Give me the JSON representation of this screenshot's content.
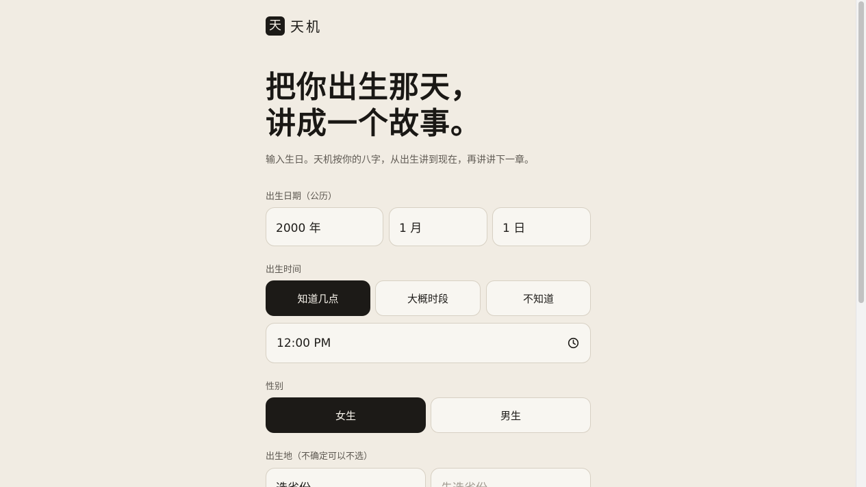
{
  "brand": {
    "logo_char": "天",
    "name": "天机"
  },
  "hero": {
    "line1": "把你出生那天，",
    "line2": "讲成一个故事。",
    "subtitle": "输入生日。天机按你的八字，从出生讲到现在，再讲讲下一章。"
  },
  "birth_date": {
    "label": "出生日期（公历）",
    "year": "2000 年",
    "month": "1 月",
    "day": "1 日"
  },
  "birth_time": {
    "label": "出生时间",
    "options": [
      {
        "label": "知道几点",
        "active": true
      },
      {
        "label": "大概时段",
        "active": false
      },
      {
        "label": "不知道",
        "active": false
      }
    ],
    "time_value": "12:00 PM",
    "icon": "clock-icon"
  },
  "gender": {
    "label": "性别",
    "options": [
      {
        "label": "女生",
        "active": true
      },
      {
        "label": "男生",
        "active": false
      }
    ]
  },
  "birthplace": {
    "label": "出生地（不确定可以不选）",
    "province_placeholder": "选省份",
    "city_placeholder": "先选省份"
  },
  "colors": {
    "background": "#f1ece3",
    "field_background": "#f8f6f1",
    "accent_dark": "#1c1a17",
    "border": "#d7d0c3"
  }
}
